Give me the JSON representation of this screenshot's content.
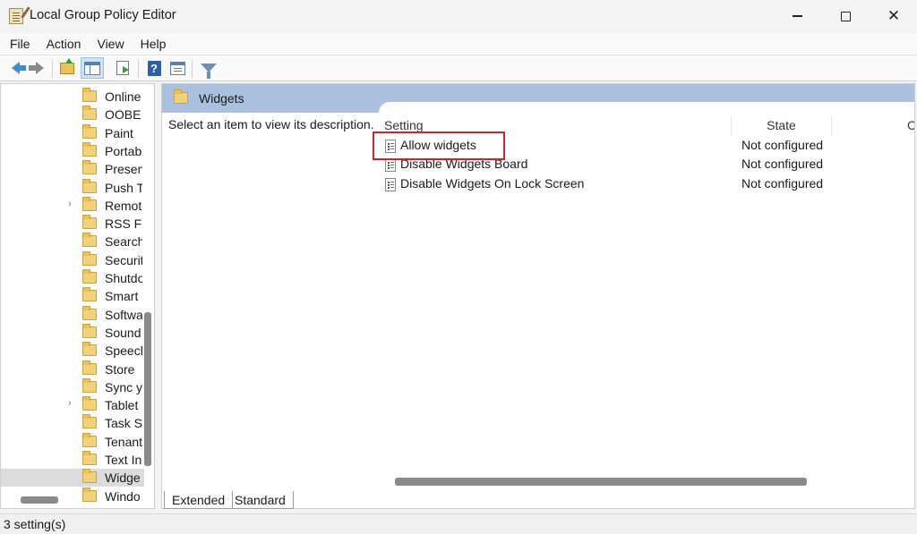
{
  "window": {
    "title": "Local Group Policy Editor",
    "minimize_glyph": "—",
    "close_glyph": "✕"
  },
  "menu": [
    "File",
    "Action",
    "View",
    "Help"
  ],
  "toolbar": {
    "icons": [
      "back-arrow-icon",
      "forward-arrow-icon",
      "up-folder-icon",
      "show-hide-tree-icon",
      "export-list-icon",
      "help-icon",
      "properties-icon",
      "filter-icon"
    ]
  },
  "tree": {
    "items": [
      {
        "label": "Online",
        "expandable": false
      },
      {
        "label": "OOBE",
        "expandable": false
      },
      {
        "label": "Paint",
        "expandable": false
      },
      {
        "label": "Portab",
        "expandable": false
      },
      {
        "label": "Presen",
        "expandable": false
      },
      {
        "label": "Push To",
        "expandable": false
      },
      {
        "label": "Remote",
        "expandable": true
      },
      {
        "label": "RSS Fe",
        "expandable": false
      },
      {
        "label": "Search",
        "expandable": false
      },
      {
        "label": "Securit",
        "expandable": false
      },
      {
        "label": "Shutdo",
        "expandable": false
      },
      {
        "label": "Smart C",
        "expandable": false
      },
      {
        "label": "Softwa",
        "expandable": false
      },
      {
        "label": "Sound",
        "expandable": false
      },
      {
        "label": "Speech",
        "expandable": false
      },
      {
        "label": "Store",
        "expandable": false
      },
      {
        "label": "Sync yo",
        "expandable": false
      },
      {
        "label": "Tablet",
        "expandable": true
      },
      {
        "label": "Task Sc",
        "expandable": false
      },
      {
        "label": "Tenant",
        "expandable": false
      },
      {
        "label": "Text Inp",
        "expandable": false
      },
      {
        "label": "Widge",
        "expandable": false,
        "selected": true
      },
      {
        "label": "Windo",
        "expandable": false
      }
    ],
    "expander_glyph": "›"
  },
  "content": {
    "folder_title": "Widgets",
    "description": "Select an item to view its description.",
    "columns": {
      "setting": "Setting",
      "state": "State",
      "comment": "C"
    },
    "rows": [
      {
        "name": "Allow widgets",
        "state": "Not configured",
        "highlighted": true
      },
      {
        "name": "Disable Widgets Board",
        "state": "Not configured"
      },
      {
        "name": "Disable Widgets On Lock Screen",
        "state": "Not configured"
      }
    ],
    "highlight_color": "#d2232a"
  },
  "tabs": {
    "extended": "Extended",
    "standard": "Standard",
    "active": "Extended"
  },
  "status": {
    "text": "3 setting(s)"
  },
  "colors": {
    "header_band": "#a9c1de",
    "folder": "#f1d17a",
    "back_arrow": "#3f8bd0"
  }
}
